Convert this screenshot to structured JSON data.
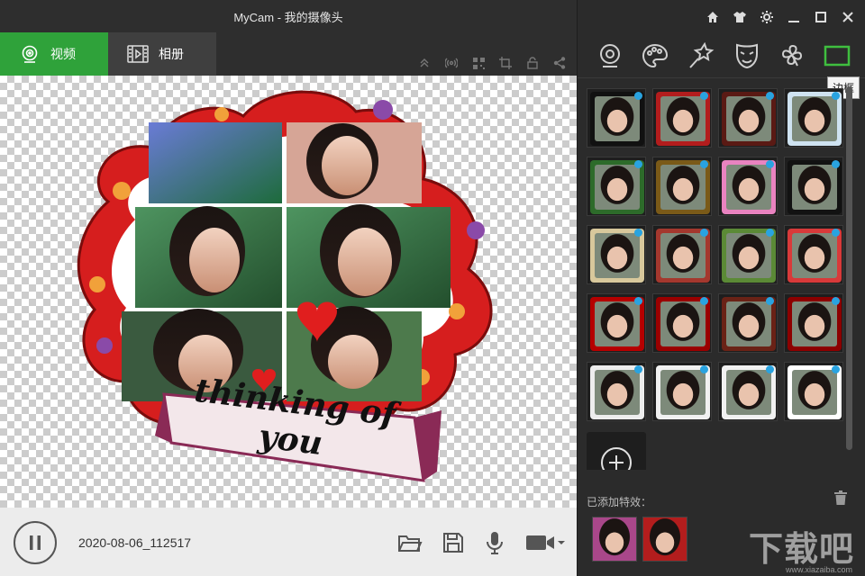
{
  "app": {
    "title": "MyCam - 我的摄像头"
  },
  "tabs": [
    {
      "label": "视频",
      "icon": "webcam-icon",
      "active": true
    },
    {
      "label": "相册",
      "icon": "film-icon",
      "active": false
    }
  ],
  "preview_tools": [
    "collapse-icon",
    "broadcast-icon",
    "qrcode-icon",
    "crop-icon",
    "lock-icon",
    "share-icon"
  ],
  "preview": {
    "caption": "thinking of you",
    "photo_count": 6
  },
  "bottom": {
    "timestamp": "2020-08-06_112517",
    "icons": [
      "folder-open-icon",
      "save-icon",
      "microphone-icon",
      "video-camera-icon"
    ]
  },
  "window_controls": [
    "home-icon",
    "skin-icon",
    "settings-icon",
    "minimize-icon",
    "maximize-icon",
    "close-icon"
  ],
  "effect_tabs": [
    {
      "icon": "webcam-icon",
      "active": false
    },
    {
      "icon": "palette-icon",
      "active": false
    },
    {
      "icon": "magic-wand-icon",
      "active": false
    },
    {
      "icon": "mask-icon",
      "active": false
    },
    {
      "icon": "clover-icon",
      "active": false
    },
    {
      "icon": "frame-icon",
      "active": true
    }
  ],
  "tooltip": "边框",
  "frames": [
    {
      "style": "camera",
      "color": "#111111"
    },
    {
      "style": "heart-red",
      "color": "#b31d1d"
    },
    {
      "style": "dark-wood",
      "color": "#5a1a14"
    },
    {
      "style": "blue-sketch",
      "color": "#cfe3f1"
    },
    {
      "style": "green-floral",
      "color": "#2d6b2a"
    },
    {
      "style": "gold-floral",
      "color": "#7a5a18"
    },
    {
      "style": "pink-ribbon",
      "color": "#e983c0"
    },
    {
      "style": "black-lace",
      "color": "#121212"
    },
    {
      "style": "heart-gold",
      "color": "#d8c89c"
    },
    {
      "style": "ribbon-bow",
      "color": "#a4382e"
    },
    {
      "style": "flower-wreath",
      "color": "#5b8a36"
    },
    {
      "style": "postcard",
      "color": "#d83a3a"
    },
    {
      "style": "time-magazine",
      "color": "#b50000"
    },
    {
      "style": "time-magazine-2",
      "color": "#9a0000"
    },
    {
      "style": "magazine-dark",
      "color": "#6a2216"
    },
    {
      "style": "magazine-red",
      "color": "#8c0000"
    },
    {
      "style": "polaroid",
      "color": "#ededed"
    },
    {
      "style": "stamp",
      "color": "#f1f1f1"
    },
    {
      "style": "stamp-2",
      "color": "#f1f1f1"
    },
    {
      "style": "window",
      "color": "#ffffff"
    }
  ],
  "added_label": "已添加特效：",
  "added_effects": [
    {
      "style": "glow",
      "color": "#a9478a"
    },
    {
      "style": "heart-red",
      "color": "#b31d1d"
    }
  ],
  "watermark": "下载吧",
  "watermark_url": "www.xiazaiba.com"
}
